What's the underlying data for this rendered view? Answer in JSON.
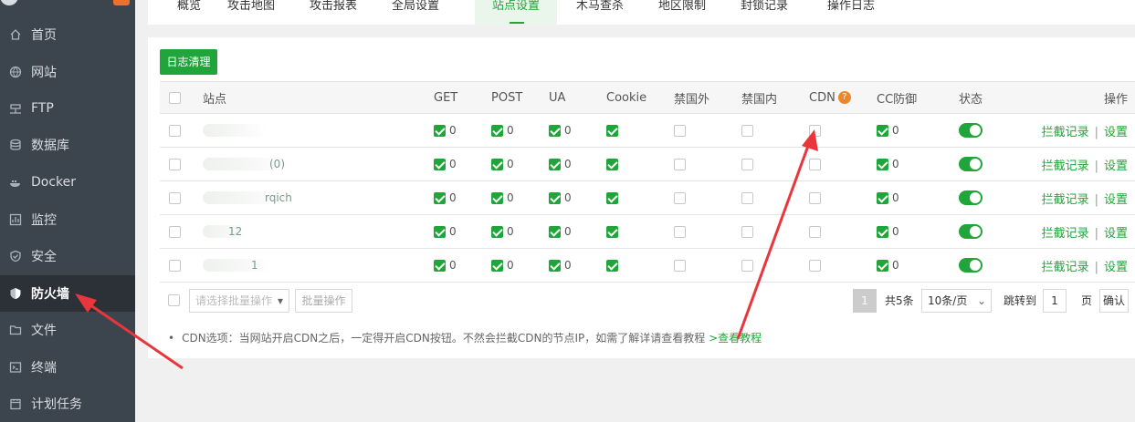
{
  "sidebar": {
    "items": [
      {
        "label": "首页",
        "icon": "home-icon"
      },
      {
        "label": "网站",
        "icon": "globe-icon"
      },
      {
        "label": "FTP",
        "icon": "ftp-icon"
      },
      {
        "label": "数据库",
        "icon": "database-icon"
      },
      {
        "label": "Docker",
        "icon": "docker-icon"
      },
      {
        "label": "监控",
        "icon": "monitor-icon"
      },
      {
        "label": "安全",
        "icon": "shield-icon"
      },
      {
        "label": "防火墙",
        "icon": "firewall-icon",
        "active": true
      },
      {
        "label": "文件",
        "icon": "folder-icon"
      },
      {
        "label": "终端",
        "icon": "terminal-icon"
      },
      {
        "label": "计划任务",
        "icon": "calendar-icon"
      }
    ]
  },
  "tabs": [
    "概览",
    "攻击地图",
    "攻击报表",
    "全局设置",
    "站点设置",
    "木马查杀",
    "地区限制",
    "封锁记录",
    "操作日志"
  ],
  "active_tab": "站点设置",
  "toolbar": {
    "clear_log": "日志清理"
  },
  "table": {
    "columns": {
      "site": "站点",
      "get": "GET",
      "post": "POST",
      "ua": "UA",
      "cookie": "Cookie",
      "foreign": "禁国外",
      "domestic": "禁国内",
      "cdn": "CDN",
      "cc": "CC防御",
      "status": "状态",
      "action": "操作"
    },
    "cdn_help": "?",
    "rows": [
      {
        "site": "",
        "get": "0",
        "post": "0",
        "ua": "0",
        "cc": "0"
      },
      {
        "site": "(0)",
        "get": "0",
        "post": "0",
        "ua": "0",
        "cc": "0"
      },
      {
        "site": "rqich",
        "get": "0",
        "post": "0",
        "ua": "0",
        "cc": "0"
      },
      {
        "site": "12",
        "get": "0",
        "post": "0",
        "ua": "0",
        "cc": "0"
      },
      {
        "site": "1",
        "get": "0",
        "post": "0",
        "ua": "0",
        "cc": "0"
      }
    ],
    "op_block_log": "拦截记录",
    "op_separator": "|",
    "op_settings": "设置"
  },
  "footer": {
    "batch_select": "请选择批量操作",
    "batch_button": "批量操作",
    "current_page": "1",
    "total": "共5条",
    "page_size": "10条/页",
    "jump_label": "跳转到",
    "jump_value": "1",
    "page_unit": "页",
    "confirm": "确认"
  },
  "notes": {
    "text": "CDN选项：当网站开启CDN之后，一定得开启CDN按钮。不然会拦截CDN的节点IP，如需了解详请查看教程",
    "link": ">查看教程"
  },
  "colors": {
    "accent": "#20a53a",
    "sidebar": "#3c444d",
    "annotation": "#e8363c",
    "help": "#f0862b"
  }
}
